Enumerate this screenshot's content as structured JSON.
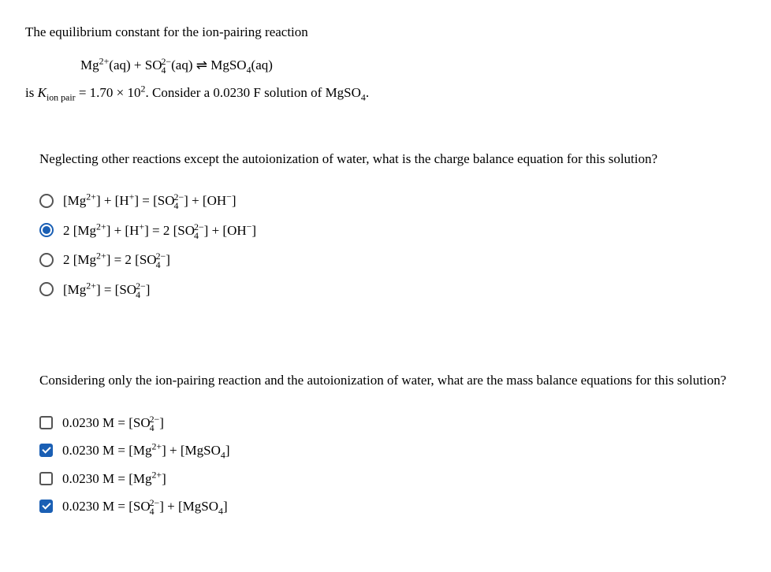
{
  "intro": {
    "line1": "The equilibrium constant for the ion-pairing reaction",
    "equation": "Mg²⁺(aq) + SO₄²⁻(aq) ⇌ MgSO₄(aq)",
    "line2_pre": "is ",
    "kvar": "K",
    "ksub": "ion pair",
    "line2_post": " = 1.70 × 10². Consider a 0.0230 F solution of MgSO₄."
  },
  "q1": {
    "text": "Neglecting other reactions except the autoionization of water, what is the charge balance equation for this solution?",
    "options": [
      {
        "selected": false,
        "label": "[Mg²⁺] + [H⁺] = [SO₄²⁻] + [OH⁻]"
      },
      {
        "selected": true,
        "label": "2 [Mg²⁺] + [H⁺] = 2 [SO₄²⁻] + [OH⁻]"
      },
      {
        "selected": false,
        "label": "2 [Mg²⁺] = 2 [SO₄²⁻]"
      },
      {
        "selected": false,
        "label": "[Mg²⁺] = [SO₄²⁻]"
      }
    ]
  },
  "q2": {
    "text": "Considering only the ion-pairing reaction and the autoionization of water, what are the mass balance equations for this solution?",
    "options": [
      {
        "checked": false,
        "label": "0.0230 M = [SO₄²⁻]"
      },
      {
        "checked": true,
        "label": "0.0230 M = [Mg²⁺] + [MgSO₄]"
      },
      {
        "checked": false,
        "label": "0.0230 M = [Mg²⁺]"
      },
      {
        "checked": true,
        "label": "0.0230 M = [SO₄²⁻] + [MgSO₄]"
      }
    ]
  }
}
